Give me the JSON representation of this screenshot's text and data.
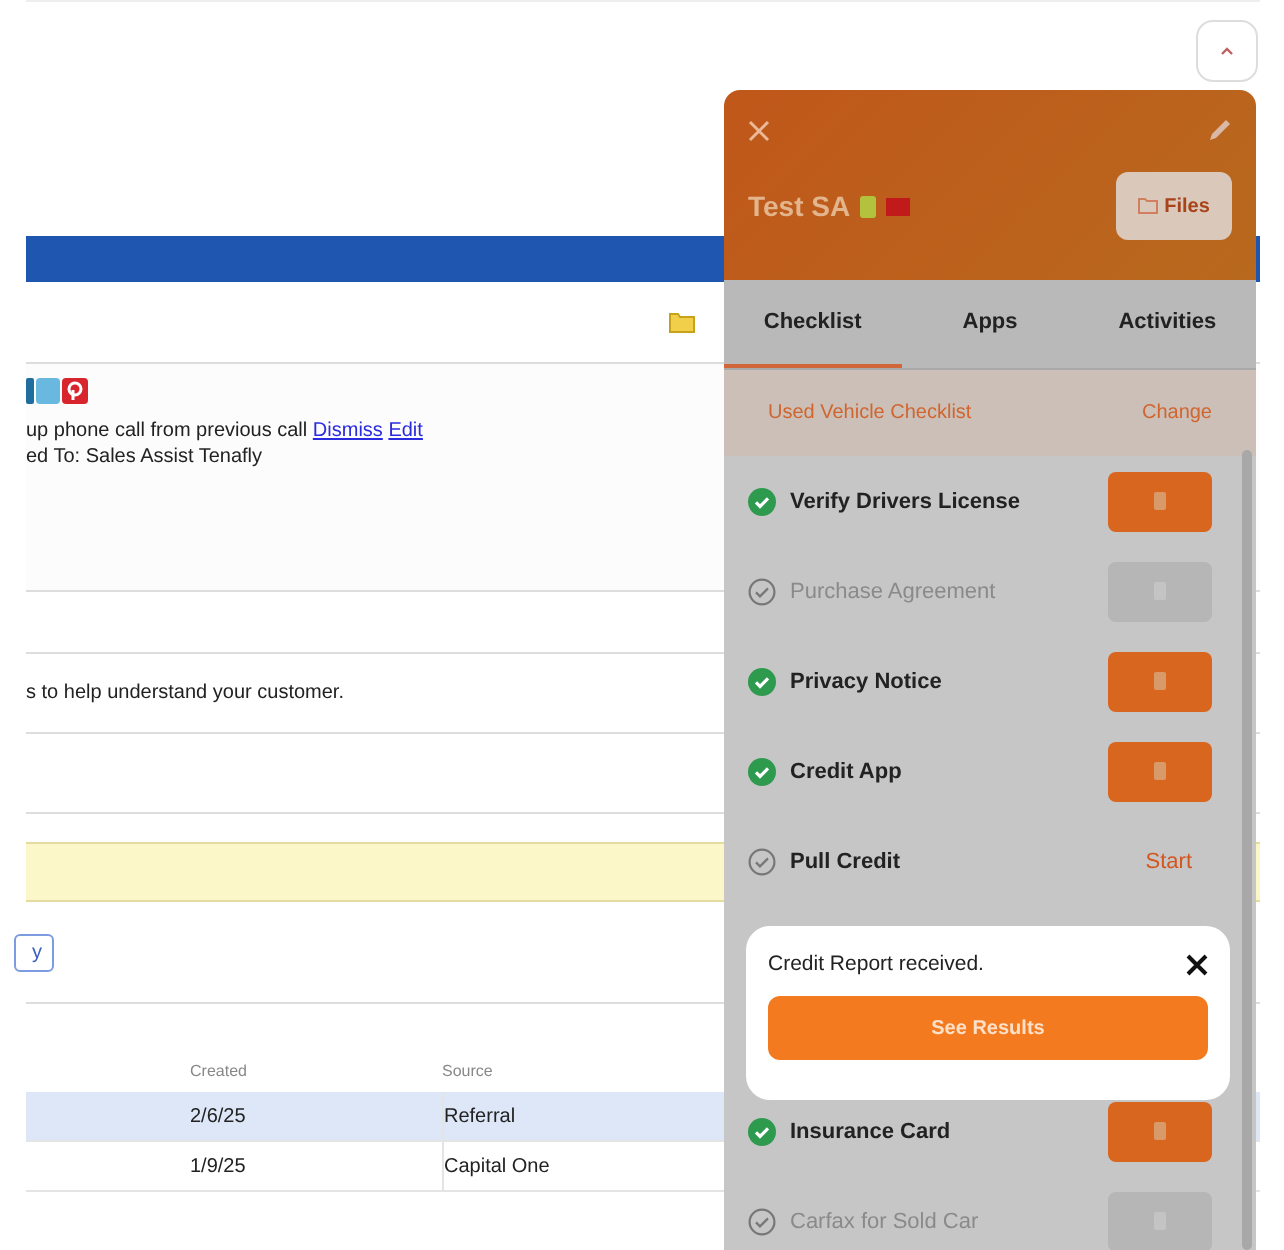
{
  "activity": {
    "note": "up phone call from previous call",
    "links": [
      "Dismiss",
      "Edit"
    ],
    "assigned": "ed To: Sales Assist Tenafly"
  },
  "info_text": "s to help understand your customer.",
  "partial_button": "y",
  "table": {
    "columns": [
      "Created",
      "Source"
    ],
    "rows": [
      {
        "cells": [
          "2/6/25",
          "Referral"
        ],
        "selected": true
      },
      {
        "cells": [
          "1/9/25",
          "Capital One"
        ],
        "selected": false
      }
    ]
  },
  "panel": {
    "title": "Test SA",
    "files_button": "Files",
    "tabs": [
      {
        "label": "Checklist",
        "selected": true
      },
      {
        "label": "Apps",
        "selected": false
      },
      {
        "label": "Activities",
        "selected": false
      }
    ],
    "checklist_name": "Used Vehicle Checklist",
    "change_link": "Change",
    "items": [
      {
        "label": "Verify Drivers License",
        "kind": "button",
        "done": true,
        "disabled": false
      },
      {
        "label": "Purchase Agreement",
        "kind": "button",
        "done": false,
        "disabled": true
      },
      {
        "label": "Privacy Notice",
        "kind": "button",
        "done": true,
        "disabled": false
      },
      {
        "label": "Credit App",
        "kind": "button",
        "done": true,
        "disabled": false
      },
      {
        "label": "Pull Credit",
        "kind": "link",
        "done": false,
        "disabled": false,
        "action": "Start"
      },
      {
        "label": "Insurance Card",
        "kind": "button",
        "done": true,
        "disabled": false
      },
      {
        "label": "Carfax for Sold Car",
        "kind": "button",
        "done": false,
        "disabled": true
      }
    ]
  },
  "toast": {
    "message": "Credit Report received.",
    "button": "See Results"
  }
}
